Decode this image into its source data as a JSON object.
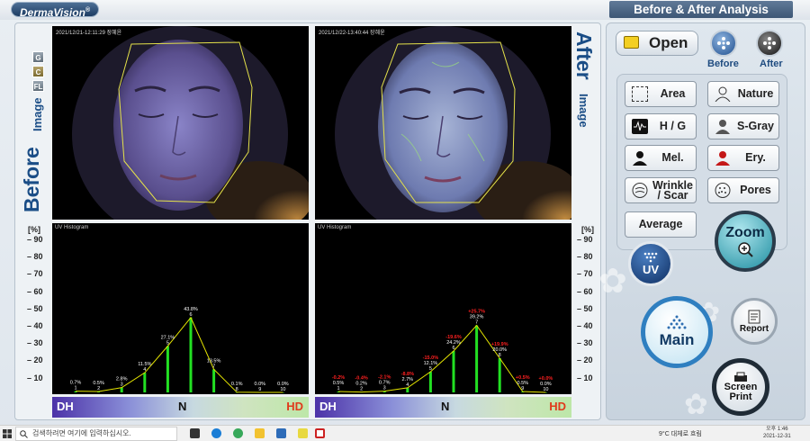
{
  "app": {
    "logo": "DermaVision",
    "logo_mark": "®",
    "title": "Before & After Analysis"
  },
  "before": {
    "side_label": "Before",
    "side_sub": "Image",
    "timestamp": "2021/12/21-12:11:29 장혜윤",
    "hist_title": "UV Histogram",
    "mini_buttons": [
      "G",
      "C",
      "FL"
    ]
  },
  "after": {
    "side_label": "After",
    "side_sub": "Image",
    "timestamp": "2021/12/22-13:40:44 장혜윤",
    "hist_title": "UV Histogram"
  },
  "yaxis": {
    "unit": "[%]",
    "ticks": [
      "90",
      "80",
      "70",
      "60",
      "50",
      "40",
      "30",
      "20",
      "10"
    ]
  },
  "scale": {
    "left": "DH",
    "center": "N",
    "right": "HD"
  },
  "chart_data": [
    {
      "type": "line",
      "title": "UV Histogram",
      "ylabel": "[%]",
      "ylim": [
        0,
        90
      ],
      "x": [
        1,
        2,
        3,
        4,
        5,
        6,
        7,
        8,
        9,
        10
      ],
      "series": [
        {
          "values": [
            0.7,
            0.5,
            2.8,
            11.5,
            27.1,
            43.8,
            13.5,
            0.1,
            0.0,
            0.0
          ]
        }
      ],
      "labels": [
        "0.7%",
        "0.5%",
        "2.8%",
        "11.5%",
        "27.1%",
        "43.8%",
        "13.5%",
        "0.1%",
        "0.0%",
        "0.0%"
      ]
    },
    {
      "type": "line",
      "title": "UV Histogram",
      "ylabel": "[%]",
      "ylim": [
        0,
        90
      ],
      "x": [
        1,
        2,
        3,
        4,
        5,
        6,
        7,
        8,
        9,
        10
      ],
      "series": [
        {
          "values": [
            0.5,
            0.2,
            0.7,
            2.7,
            12.1,
            24.2,
            39.2,
            20.0,
            0.5,
            0.0
          ]
        }
      ],
      "labels": [
        "0.5%",
        "0.2%",
        "0.7%",
        "2.7%",
        "12.1%",
        "24.2%",
        "39.2%",
        "20.0%",
        "0.5%",
        "0.0%"
      ],
      "changes": [
        "-0.2%",
        "-0.4%",
        "-2.1%",
        "-8.8%",
        "-15.0%",
        "-19.6%",
        "+25.7%",
        "+19.9%",
        "+0.5%",
        "+0.0%"
      ]
    }
  ],
  "controls": {
    "open": "Open",
    "before": "Before",
    "after": "After",
    "tools": [
      {
        "label": "Area",
        "icon": "area-icon"
      },
      {
        "label": "Nature",
        "icon": "person-outline-icon"
      },
      {
        "label": "H / G",
        "icon": "waveform-icon"
      },
      {
        "label": "S-Gray",
        "icon": "person-gray-icon"
      },
      {
        "label": "Mel.",
        "icon": "person-dark-icon"
      },
      {
        "label": "Ery.",
        "icon": "person-red-icon"
      },
      {
        "label": "Wrinkle / Scar",
        "icon": "wrinkle-icon"
      },
      {
        "label": "Pores",
        "icon": "pores-icon"
      },
      {
        "label": "Average",
        "icon": ""
      }
    ],
    "uv": "UV",
    "zoom": "Zoom",
    "main": "Main",
    "report": "Report",
    "screen_print": "Screen Print"
  },
  "taskbar": {
    "search_placeholder": "검색하려면 여기에 입력하십시오.",
    "weather": "9°C 대체로 흐림",
    "time": "오후 1:46",
    "date": "2021-12-31"
  },
  "colors": {
    "accent": "#1a4d86",
    "bar_green": "#22e022",
    "line_yellow": "#e6e600",
    "change_red": "#ff2020"
  }
}
